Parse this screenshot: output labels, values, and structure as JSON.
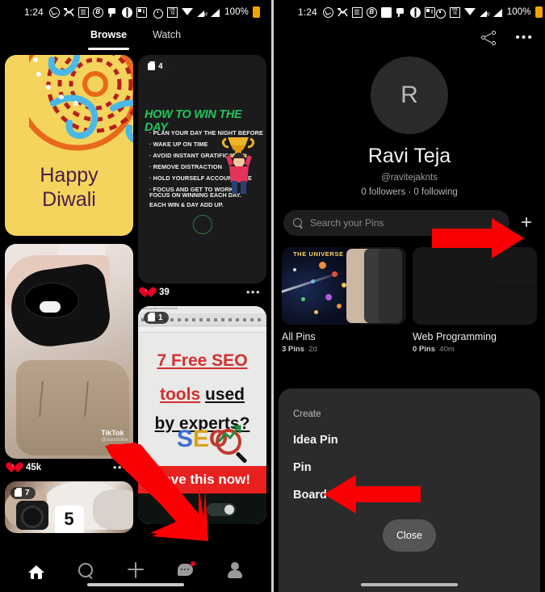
{
  "left_phone": {
    "status_bar": {
      "time": "1:24",
      "left_icons": [
        "whatsapp-icon",
        "call-icon",
        "document-icon",
        "b-circle-icon",
        "pin-icon",
        "globe-icon",
        "news-icon"
      ],
      "right_icons": [
        "alarm-icon",
        "volte-icon",
        "wifi-icon",
        "signal-r-icon",
        "signal-icon"
      ],
      "battery_percent": "100%"
    },
    "tabs": [
      {
        "label": "Browse",
        "active": true
      },
      {
        "label": "Watch",
        "active": false
      }
    ],
    "pins": [
      {
        "id": "diwali",
        "greeting_line1": "Happy",
        "greeting_line2": "Diwali",
        "bg_color": "#f4d45c",
        "text_color": "#4a1c4a"
      },
      {
        "id": "win-the-day",
        "badge_count": "4",
        "headline": "HOW TO WIN THE DAY",
        "headline_color": "#22c55e",
        "bullets": [
          "PLAN YOUR DAY THE NIGHT BEFORE",
          "WAKE UP ON TIME",
          "AVOID INSTANT GRATIFICATION",
          "REMOVE DISTRACTION",
          "HOLD YOURSELF ACCOUNTABLE",
          "FOCUS AND GET TO WORK."
        ],
        "footer_line1": "FOCUS ON WINNING EACH DAY.",
        "footer_line2": "EACH WIN & DAY ADD UP.",
        "like_count": "39"
      },
      {
        "id": "tiktok-shoe",
        "watermark": "TikTok",
        "watermark_handle": "@daviddkw",
        "like_count": "45k"
      },
      {
        "id": "seo-tools",
        "badge_count": "1",
        "title_line1": "7 Free SEO",
        "title_line2_red": "tools",
        "title_line2_black": "used",
        "title_line3": "by experts?",
        "logo_s": "S",
        "logo_e": "E",
        "logo_o": "O",
        "banner_text": "Save this now!",
        "banner_color": "#e8201e"
      },
      {
        "id": "bed-camera",
        "badge_count": "7",
        "overlay_number": "5"
      }
    ],
    "bottom_nav": [
      {
        "name": "home-nav-icon",
        "active": true
      },
      {
        "name": "search-nav-icon",
        "active": false
      },
      {
        "name": "create-nav-icon",
        "active": false
      },
      {
        "name": "messages-nav-icon",
        "active": false,
        "has_badge": true
      },
      {
        "name": "profile-nav-icon",
        "active": false
      }
    ]
  },
  "right_phone": {
    "status_bar": {
      "time": "1:24",
      "left_icons": [
        "whatsapp-icon",
        "call-icon",
        "document-icon",
        "b-circle-icon",
        "image-icon",
        "pin-icon",
        "globe-icon",
        "news-icon"
      ],
      "right_icons": [
        "alarm-icon",
        "volte-icon",
        "wifi-icon",
        "signal-r-icon",
        "signal-icon"
      ],
      "battery_percent": "100%"
    },
    "top_actions": [
      "share-icon",
      "overflow-menu-icon"
    ],
    "profile": {
      "avatar_initial": "R",
      "name": "Ravi Teja",
      "handle": "@ravitejaknts",
      "stats": "0 followers · 0 following"
    },
    "search": {
      "placeholder": "Search your Pins",
      "icon": "search-icon"
    },
    "add_button_label": "+",
    "boards": [
      {
        "name": "All Pins",
        "pin_count": "3 Pins",
        "updated": "2d",
        "thumb": "universe-poster"
      },
      {
        "name": "Web Programming",
        "pin_count": "0 Pins",
        "updated": "40m",
        "thumb": "empty-grid"
      }
    ],
    "create_sheet": {
      "header": "Create",
      "options": [
        "Idea Pin",
        "Pin",
        "Board"
      ],
      "close_label": "Close"
    }
  },
  "annotations": {
    "arrow_color": "#fa0005",
    "arrows": [
      {
        "name": "arrow-to-add-board-plus",
        "direction": "right"
      },
      {
        "name": "arrow-to-profile-tab",
        "direction": "down-right"
      },
      {
        "name": "arrow-to-board-option",
        "direction": "left"
      }
    ]
  }
}
